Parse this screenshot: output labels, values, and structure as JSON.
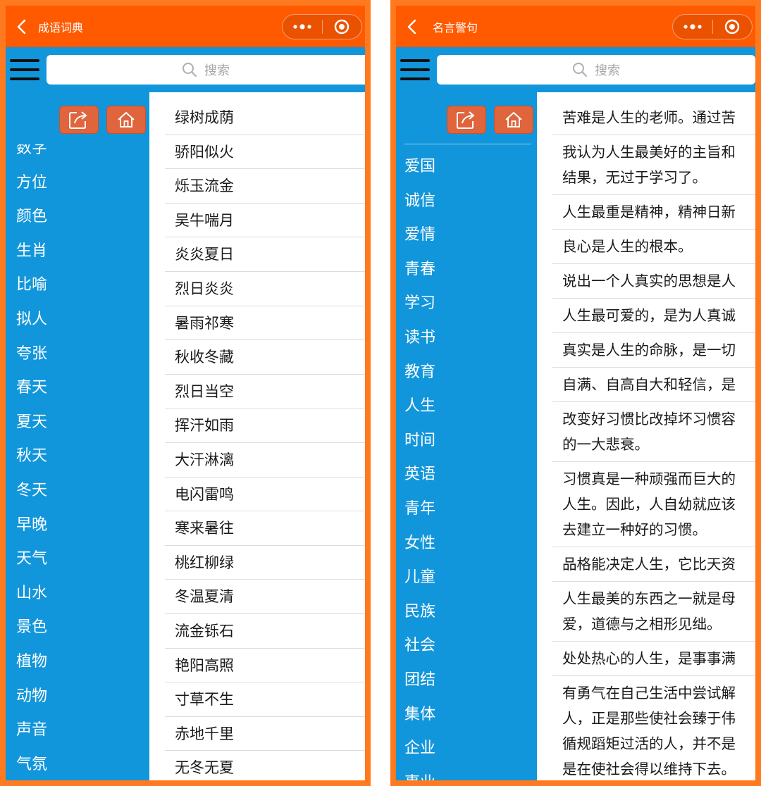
{
  "colors": {
    "frame": "#ff7a1f",
    "navbar": "#ff5a00",
    "sidebar": "#1296db",
    "action_button": "#e0643c"
  },
  "left_app": {
    "navbar": {
      "title": "成语词典"
    },
    "search": {
      "placeholder": "搜索"
    },
    "categories": [
      "数字",
      "方位",
      "颜色",
      "生肖",
      "比喻",
      "拟人",
      "夸张",
      "春天",
      "夏天",
      "秋天",
      "冬天",
      "早晚",
      "天气",
      "山水",
      "景色",
      "植物",
      "动物",
      "声音",
      "气氛"
    ],
    "words": [
      "绿树成荫",
      "骄阳似火",
      "烁玉流金",
      "吴牛喘月",
      "炎炎夏日",
      "烈日炎炎",
      "暑雨祁寒",
      "秋收冬藏",
      "烈日当空",
      "挥汗如雨",
      "大汗淋漓",
      "电闪雷鸣",
      "寒来暑往",
      "桃红柳绿",
      "冬温夏清",
      "流金铄石",
      "艳阳高照",
      "寸草不生",
      "赤地千里",
      "无冬无夏"
    ]
  },
  "right_app": {
    "navbar": {
      "title": "名言警句"
    },
    "search": {
      "placeholder": "搜索"
    },
    "categories": [
      "爱国",
      "诚信",
      "爱情",
      "青春",
      "学习",
      "读书",
      "教育",
      "人生",
      "时间",
      "英语",
      "青年",
      "女性",
      "儿童",
      "民族",
      "社会",
      "团结",
      "集体",
      "企业",
      "事业"
    ],
    "quotes": [
      "苦难是人生的老师。通过苦",
      "我认为人生最美好的主旨和\n结果，无过于学习了。",
      "人生最重是精神，精神日新",
      "良心是人生的根本。",
      "说出一个人真实的思想是人",
      "人生最可爱的，是为人真诚",
      "真实是人生的命脉，是一切",
      "自满、自高自大和轻信，是",
      "改变好习惯比改掉坏习惯容\n的一大悲衰。",
      "习惯真是一种顽强而巨大的\n人生。因此，人自幼就应该\n去建立一种好的习惯。",
      "品格能决定人生，它比天资",
      "人生最美的东西之一就是母\n爱，道德与之相形见绌。",
      "处处热心的人生，是事事满",
      "有勇气在自己生活中尝试解\n人，正是那些使社会臻于伟\n循规蹈矩过活的人，并不是\n是在使社会得以维持下去。"
    ]
  }
}
